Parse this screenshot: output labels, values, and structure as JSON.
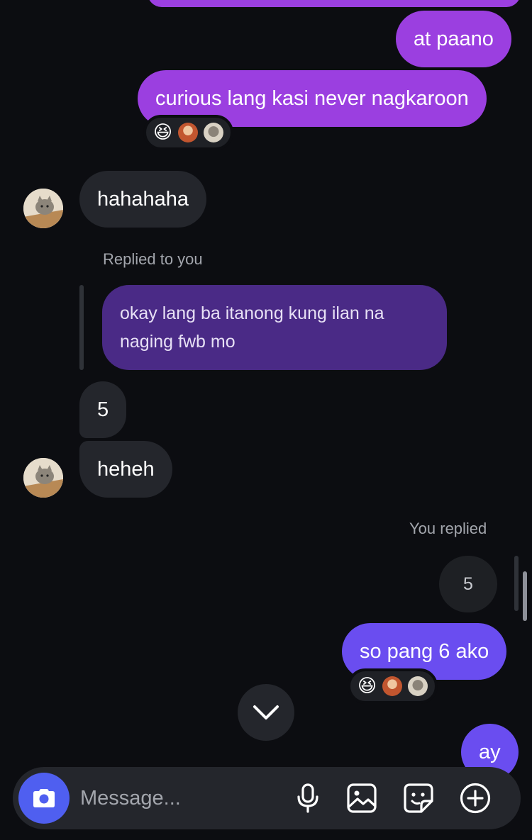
{
  "messages": {
    "m1": "at paano",
    "m2": "curious lang kasi never nagkaroon",
    "m3": "hahahaha",
    "replied_label": "Replied to you",
    "quoted": "okay lang ba itanong kung ilan na naging fwb mo",
    "quoted_line1": "okay lang ba itanong kung ilan na",
    "quoted_line2": "naging fwb mo",
    "m4": "5",
    "m5": "heheh",
    "you_replied_label": "You replied",
    "quoted_mine": "5",
    "m6": "so pang 6 ako",
    "m7": "ay"
  },
  "reactions": {
    "r1": {
      "emoji": "😆",
      "avatars": [
        "orange-avatar",
        "gray-avatar"
      ]
    },
    "r2": {
      "emoji": "😆",
      "avatars": [
        "orange-avatar",
        "gray-avatar"
      ]
    }
  },
  "composer": {
    "placeholder": "Message...",
    "icons": [
      "camera-icon",
      "microphone-icon",
      "image-icon",
      "sticker-icon",
      "add-icon"
    ]
  },
  "colors": {
    "background": "#0c0d11",
    "incoming_bubble": "#24262c",
    "outgoing_purple": "#9b3fe0",
    "outgoing_violet": "#7c49e8",
    "outgoing_indigo": "#6a4df0",
    "camera_button": "#4f5ff0"
  }
}
